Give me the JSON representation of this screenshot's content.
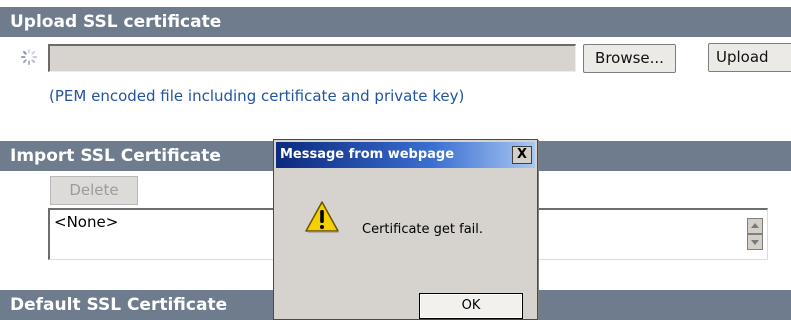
{
  "upload_section": {
    "title": "Upload SSL certificate",
    "file_input_value": "",
    "browse_label": "Browse...",
    "upload_label": "Upload",
    "hint": "(PEM encoded file including certificate and private key)"
  },
  "import_section": {
    "title": "Import SSL Certificate",
    "delete_label": "Delete",
    "list_items": [
      "<None>"
    ]
  },
  "default_section": {
    "title": "Default SSL Certificate"
  },
  "dialog": {
    "title": "Message from webpage",
    "close_label": "X",
    "message": "Certificate get fail.",
    "ok_label": "OK",
    "icon": "warning-icon"
  },
  "colors": {
    "header_bg": "#6f7c8d",
    "hint_text": "#2255a0",
    "titlebar_start": "#0c2a7e",
    "titlebar_end": "#a8c8f2"
  }
}
